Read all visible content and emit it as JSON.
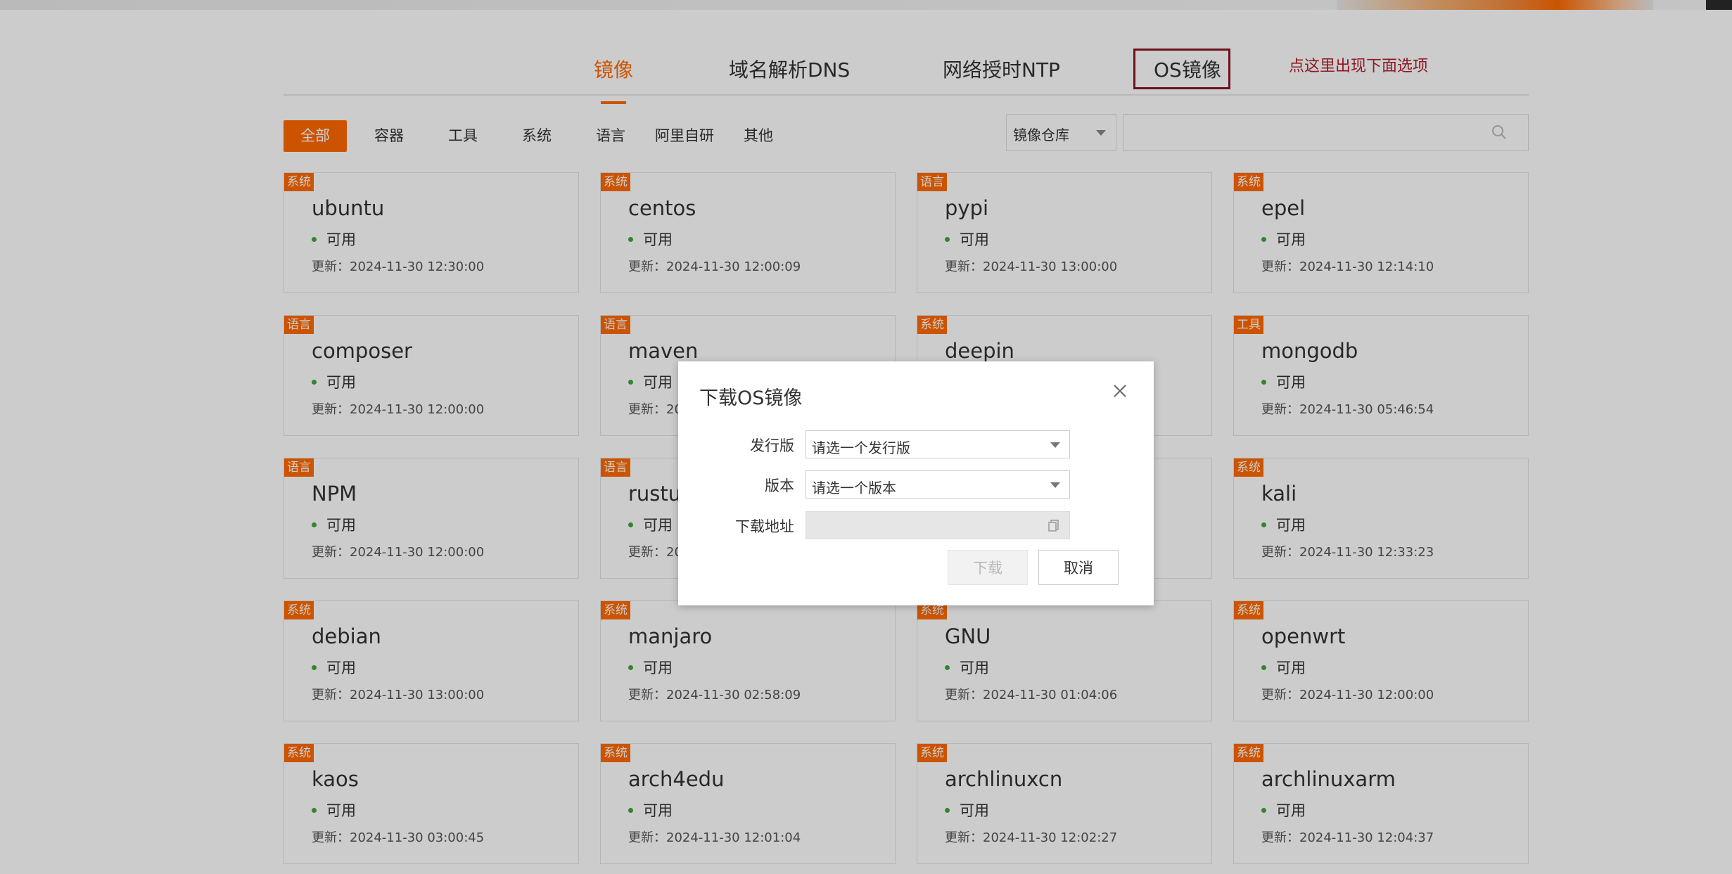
{
  "main_tabs": [
    "镜像",
    "域名解析DNS",
    "网络授时NTP",
    "OS镜像"
  ],
  "annotation_note": "点这里出现下面选项",
  "filters": [
    "全部",
    "容器",
    "工具",
    "系统",
    "语言",
    "阿里自研",
    "其他"
  ],
  "repo_select": "镜像仓库",
  "search": {
    "value": ""
  },
  "accent_color": "#ff6a00",
  "status_color": "#3fa63f",
  "icons": {
    "search": "search-icon",
    "close": "close-icon",
    "copy": "copy-icon",
    "dropdown": "chevron-down-icon"
  },
  "cards": [
    {
      "tag": "系统",
      "name": "ubuntu",
      "status": "可用",
      "updated": "更新：2024-11-30 12:30:00"
    },
    {
      "tag": "系统",
      "name": "centos",
      "status": "可用",
      "updated": "更新：2024-11-30 12:00:09"
    },
    {
      "tag": "语言",
      "name": "pypi",
      "status": "可用",
      "updated": "更新：2024-11-30 13:00:00"
    },
    {
      "tag": "系统",
      "name": "epel",
      "status": "可用",
      "updated": "更新：2024-11-30 12:14:10"
    },
    {
      "tag": "语言",
      "name": "composer",
      "status": "可用",
      "updated": "更新：2024-11-30 12:00:00"
    },
    {
      "tag": "语言",
      "name": "maven",
      "status": "可用",
      "updated": "更新：20"
    },
    {
      "tag": "系统",
      "name": "deepin",
      "status": "",
      "updated": ""
    },
    {
      "tag": "工具",
      "name": "mongodb",
      "status": "可用",
      "updated": "更新：2024-11-30 05:46:54"
    },
    {
      "tag": "语言",
      "name": "NPM",
      "status": "可用",
      "updated": "更新：2024-11-30 12:00:00"
    },
    {
      "tag": "语言",
      "name": "rustup",
      "status": "可用",
      "updated": "更新：20"
    },
    {
      "tag": "",
      "name": "",
      "status": "",
      "updated": ""
    },
    {
      "tag": "系统",
      "name": "kali",
      "status": "可用",
      "updated": "更新：2024-11-30 12:33:23"
    },
    {
      "tag": "系统",
      "name": "debian",
      "status": "可用",
      "updated": "更新：2024-11-30 13:00:00"
    },
    {
      "tag": "系统",
      "name": "manjaro",
      "status": "可用",
      "updated": "更新：2024-11-30 02:58:09"
    },
    {
      "tag": "系统",
      "name": "GNU",
      "status": "可用",
      "updated": "更新：2024-11-30 01:04:06"
    },
    {
      "tag": "系统",
      "name": "openwrt",
      "status": "可用",
      "updated": "更新：2024-11-30 12:00:00"
    },
    {
      "tag": "系统",
      "name": "kaos",
      "status": "可用",
      "updated": "更新：2024-11-30 03:00:45"
    },
    {
      "tag": "系统",
      "name": "arch4edu",
      "status": "可用",
      "updated": "更新：2024-11-30 12:01:04"
    },
    {
      "tag": "系统",
      "name": "archlinuxcn",
      "status": "可用",
      "updated": "更新：2024-11-30 12:02:27"
    },
    {
      "tag": "系统",
      "name": "archlinuxarm",
      "status": "可用",
      "updated": "更新：2024-11-30 12:04:37"
    }
  ],
  "modal": {
    "title": "下载OS镜像",
    "distro_label": "发行版",
    "distro_placeholder": "请选一个发行版",
    "version_label": "版本",
    "version_placeholder": "请选一个版本",
    "url_label": "下载地址",
    "url_value": "",
    "download_label": "下载",
    "cancel_label": "取消"
  }
}
